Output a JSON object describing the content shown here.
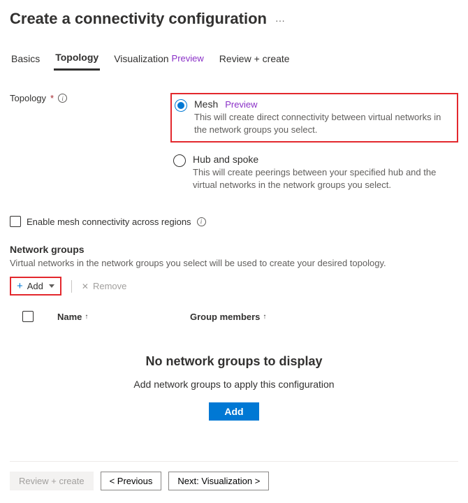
{
  "header": {
    "title": "Create a connectivity configuration"
  },
  "tabs": {
    "basics": "Basics",
    "topology": "Topology",
    "visualization": "Visualization",
    "visualization_badge": "Preview",
    "review": "Review + create"
  },
  "form": {
    "topology_label": "Topology"
  },
  "options": {
    "mesh": {
      "label": "Mesh",
      "badge": "Preview",
      "desc": "This will create direct connectivity between virtual networks in the network groups you select."
    },
    "hubspoke": {
      "label": "Hub and spoke",
      "desc": "This will create peerings between your specified hub and the virtual networks in the network groups you select."
    }
  },
  "mesh_checkbox": "Enable mesh connectivity across regions",
  "network_groups": {
    "title": "Network groups",
    "desc": "Virtual networks in the network groups you select will be used to create your desired topology."
  },
  "toolbar": {
    "add": "Add",
    "remove": "Remove"
  },
  "columns": {
    "name": "Name",
    "members": "Group members"
  },
  "empty": {
    "title": "No network groups to display",
    "desc": "Add network groups to apply this configuration",
    "add": "Add"
  },
  "footer": {
    "review": "Review + create",
    "prev": "< Previous",
    "next": "Next: Visualization >"
  }
}
